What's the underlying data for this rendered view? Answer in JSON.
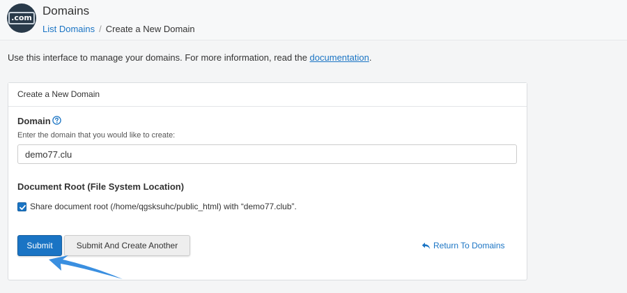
{
  "header": {
    "logo_text": ".com",
    "title": "Domains",
    "breadcrumb": {
      "link": "List Domains",
      "separator": "/",
      "current": "Create a New Domain"
    }
  },
  "intro": {
    "text": "Use this interface to manage your domains. For more information, read the ",
    "link": "documentation",
    "suffix": "."
  },
  "panel": {
    "heading": "Create a New Domain",
    "domain": {
      "label": "Domain",
      "help_icon": "question-circle-icon",
      "help_text": "Enter the domain that you would like to create:",
      "value": "demo77.clu"
    },
    "document_root": {
      "label": "Document Root (File System Location)",
      "share_checked": true,
      "share_label": "Share document root (/home/qgsksuhc/public_html) with “demo77.club”."
    },
    "buttons": {
      "submit": "Submit",
      "submit_another": "Submit And Create Another"
    },
    "return_link": {
      "icon": "reply-arrow-icon",
      "label": "Return To Domains"
    }
  },
  "colors": {
    "accent": "#1a74c4",
    "logo_bg": "#293a4a",
    "pointer_arrow": "#3a8fe0"
  }
}
